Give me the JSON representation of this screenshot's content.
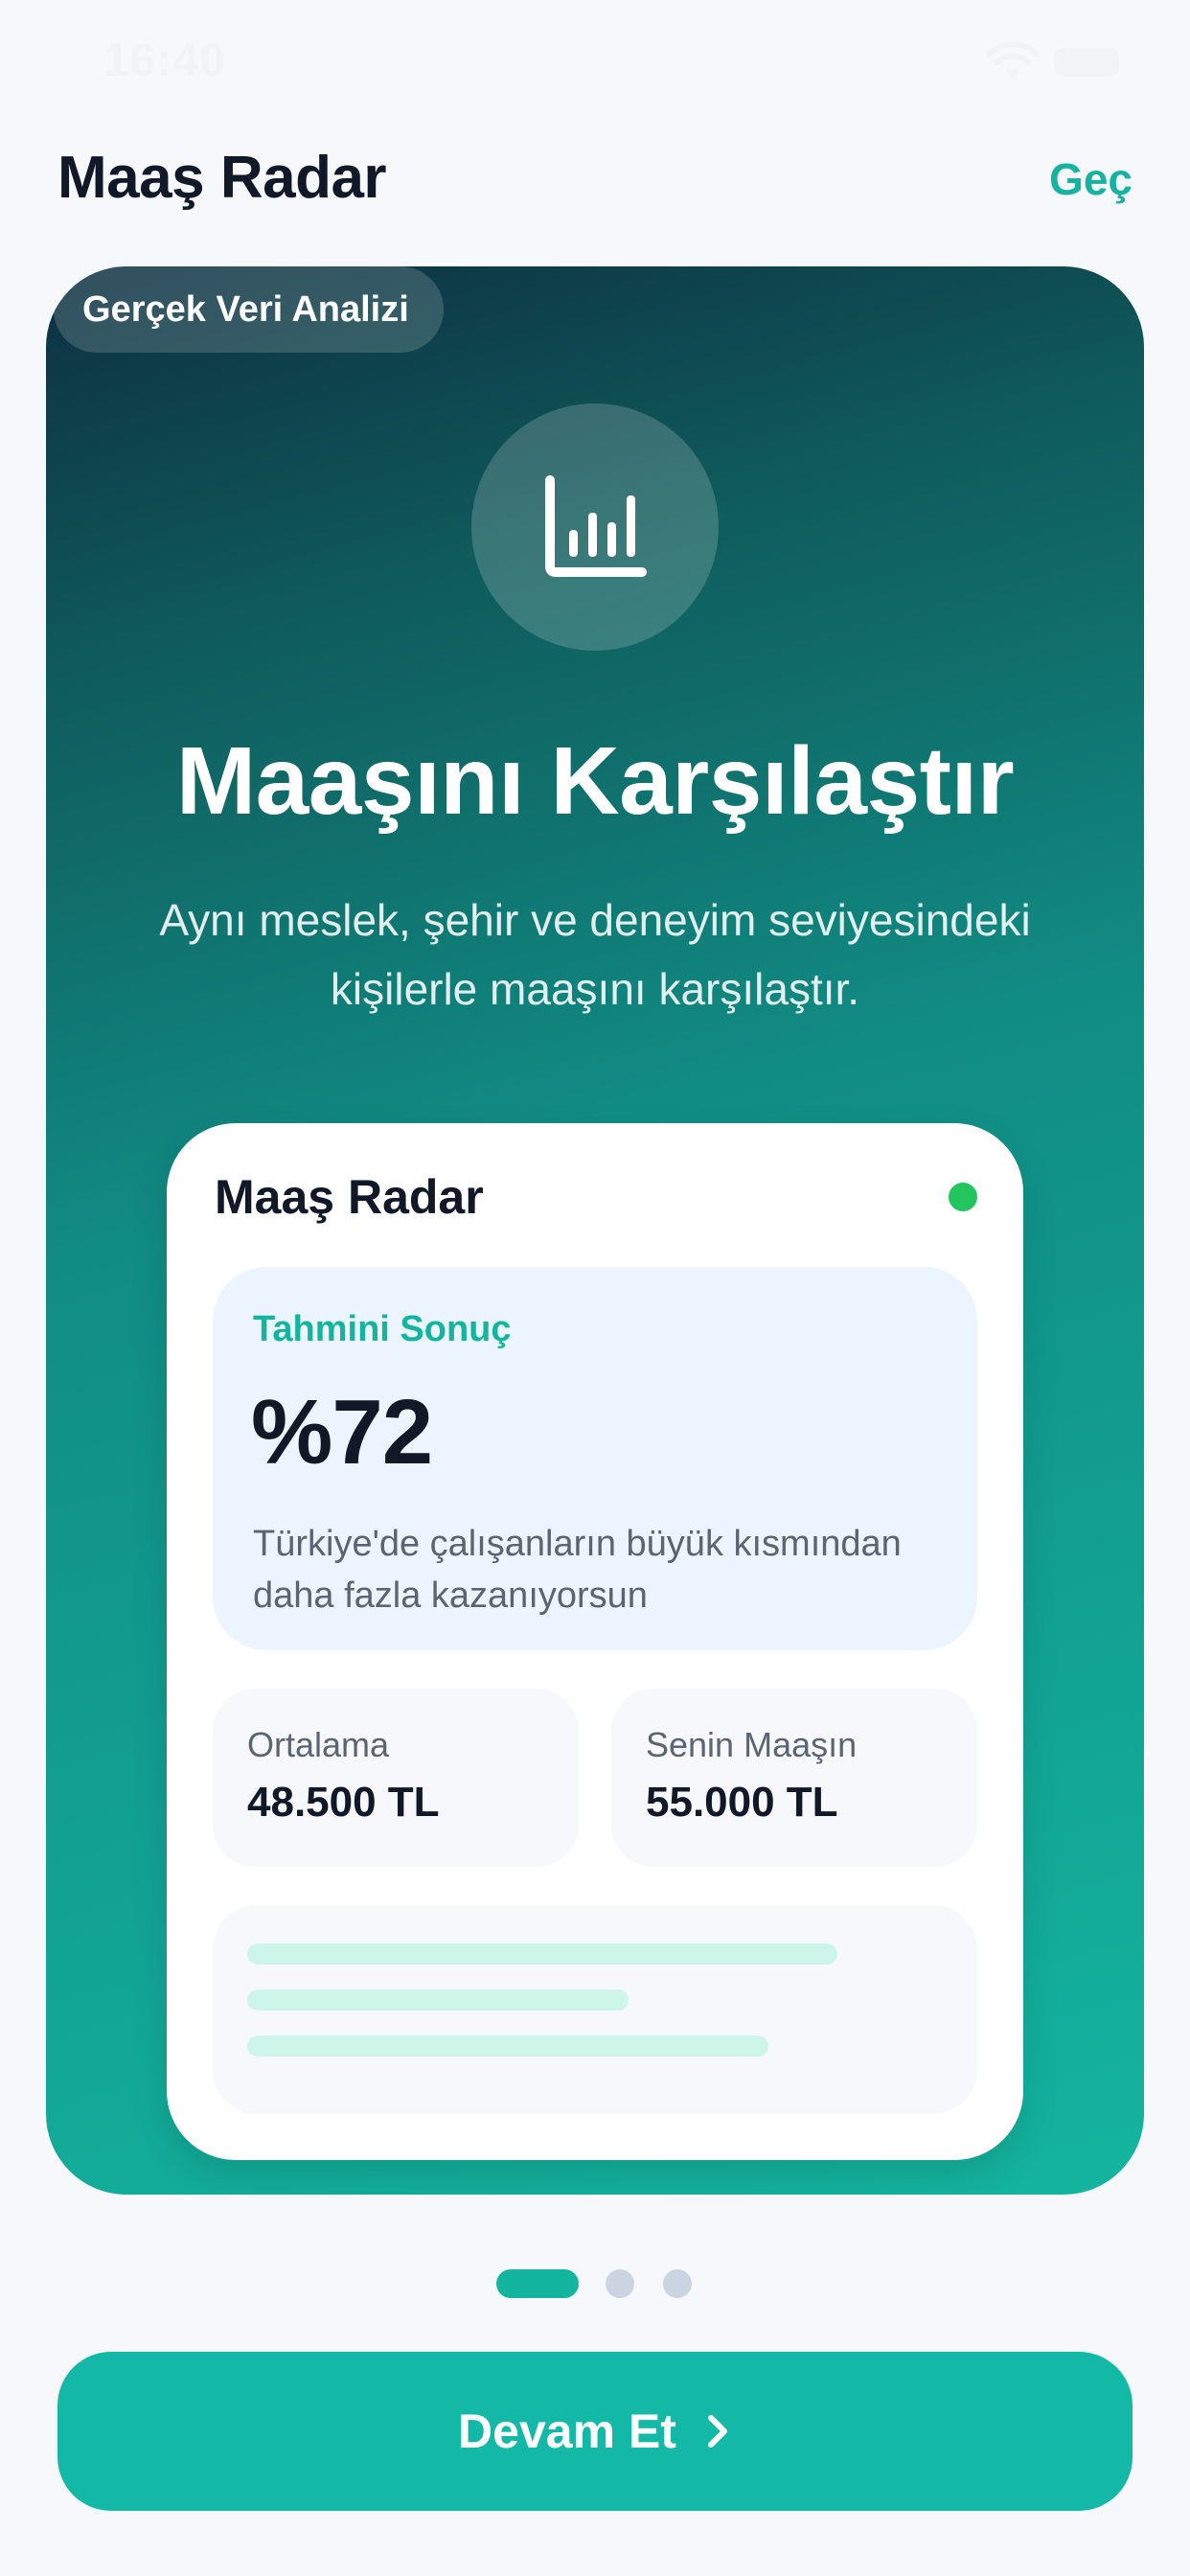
{
  "status_bar": {
    "time": "16:40",
    "wifi_icon": "wifi-icon",
    "battery_icon": "battery-icon"
  },
  "header": {
    "title": "Maaş Radar",
    "skip_label": "Geç"
  },
  "hero": {
    "badge": "Gerçek Veri Analizi",
    "icon": "bar-chart-icon",
    "title": "Maaşını Karşılaştır",
    "subtitle": "Aynı meslek, şehir ve deneyim seviyesindeki kişilerle maaşını karşılaştır."
  },
  "preview_card": {
    "title": "Maaş Radar",
    "status_color": "#22c55e",
    "result": {
      "label": "Tahmini Sonuç",
      "value": "%72",
      "description": "Türkiye'de çalışanların büyük kısmından daha fazla kazanıyorsun"
    },
    "stats": [
      {
        "label": "Ortalama",
        "value": "48.500 TL"
      },
      {
        "label": "Senin Maaşın",
        "value": "55.000 TL"
      }
    ]
  },
  "pager": {
    "total": 3,
    "active_index": 0
  },
  "continue_button": {
    "label": "Devam Et",
    "icon": "chevron-right-icon"
  },
  "colors": {
    "accent": "#14b8a6",
    "text_dark": "#111827",
    "background": "#f6f8fb"
  }
}
